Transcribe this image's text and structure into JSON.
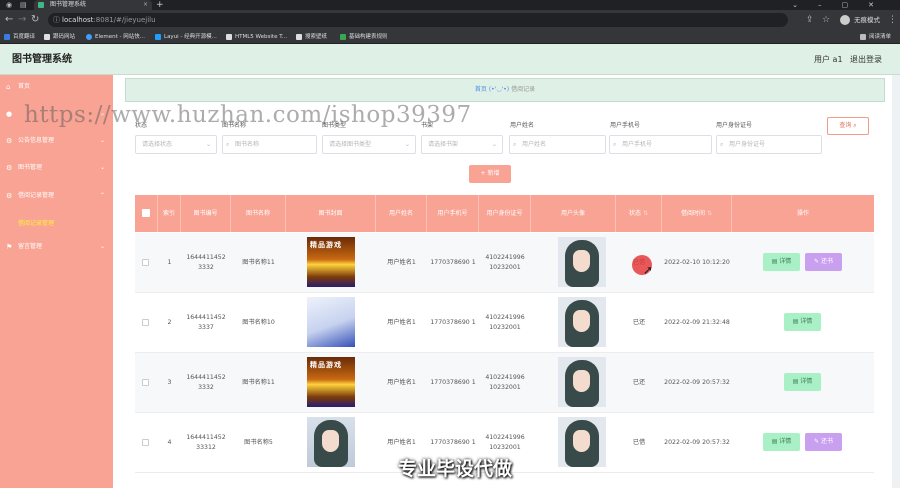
{
  "browser": {
    "tab_title": "图书管理系统",
    "url_host": "localhost",
    "url_path": ":8081/#/jieyuejilu",
    "profile_label": "无痕模式",
    "bookmarks": [
      "百度翻译",
      "跟码网站",
      "Element - 网站快...",
      "Layui - 经典开源模...",
      "HTML5 Website T...",
      "搜索壁纸",
      "基础构建表规则"
    ],
    "bookmark_right": "阅读清单"
  },
  "header": {
    "title": "图书管理系统",
    "user": "用户 a1",
    "logout": "退出登录"
  },
  "sidebar": {
    "items": [
      {
        "label": "首页",
        "icon": "home-icon"
      },
      {
        "label": "",
        "icon": "user-icon"
      },
      {
        "label": "公告信息管理",
        "icon": "settings-icon"
      },
      {
        "label": "图书管理",
        "icon": "settings-icon"
      },
      {
        "label": "借阅记录管理",
        "icon": "settings-icon"
      },
      {
        "label": "留言管理",
        "icon": "flag-icon"
      }
    ],
    "active_sub": "借阅记录管理"
  },
  "breadcrumb": {
    "home": "首页",
    "face": "(•'◡'•)",
    "current": "借阅记录"
  },
  "filters": [
    {
      "label": "状态",
      "placeholder": "请选择状态"
    },
    {
      "label": "图书名称",
      "placeholder": "图书名称"
    },
    {
      "label": "图书类型",
      "placeholder": "请选择图书类型"
    },
    {
      "label": "书架",
      "placeholder": "请选择书架"
    },
    {
      "label": "用户姓名",
      "placeholder": "用户姓名"
    },
    {
      "label": "用户手机号",
      "placeholder": "用户手机号"
    },
    {
      "label": "用户身份证号",
      "placeholder": "用户身份证号"
    }
  ],
  "buttons": {
    "query": "查询",
    "add": "新增",
    "detail": "详情",
    "return": "还书"
  },
  "table": {
    "columns": [
      "索引",
      "图书编号",
      "图书名称",
      "图书封面",
      "用户姓名",
      "用户手机号",
      "用户身份证号",
      "用户头像",
      "状态",
      "借阅时间",
      "操作"
    ],
    "rows": [
      {
        "index": "1",
        "book_no": "1644411452 3332",
        "book_name": "图书名称11",
        "user": "用户姓名1",
        "phone": "1770378690 1",
        "id_card": "4102241996 10232001",
        "status": "已借",
        "time": "2022-02-10 10:12:20",
        "cover": "game",
        "can_return": true
      },
      {
        "index": "2",
        "book_no": "1644411452 3337",
        "book_name": "图书名称10",
        "user": "用户姓名1",
        "phone": "1770378690 1",
        "id_card": "4102241996 10232001",
        "status": "已还",
        "time": "2022-02-09 21:32:48",
        "cover": "doc",
        "can_return": false
      },
      {
        "index": "3",
        "book_no": "1644411452 3332",
        "book_name": "图书名称11",
        "user": "用户姓名1",
        "phone": "1770378690 1",
        "id_card": "4102241996 10232001",
        "status": "已还",
        "time": "2022-02-09 20:57:32",
        "cover": "game",
        "can_return": false
      },
      {
        "index": "4",
        "book_no": "1644411452 33312",
        "book_name": "图书名称5",
        "user": "用户姓名1",
        "phone": "1770378690 1",
        "id_card": "4102241996 10232001",
        "status": "已借",
        "time": "2022-02-09 20:57:32",
        "cover": "girl",
        "can_return": true
      }
    ]
  },
  "cover_caption": "精品游戏",
  "watermark": "https://www.huzhan.com/ishop39397",
  "video_caption": "专业毕设代做",
  "colors": {
    "accent": "#f8a394",
    "header_bg": "#dff0e6",
    "detail_btn": "#aaf0c6",
    "return_btn": "#c99ff0"
  }
}
